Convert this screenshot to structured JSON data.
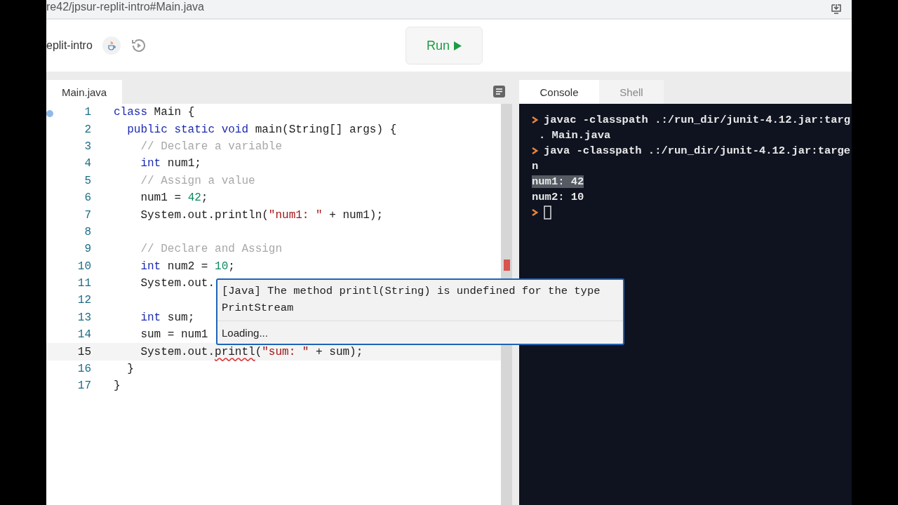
{
  "address_bar": {
    "url": "re42/jpsur-replit-intro#Main.java"
  },
  "header": {
    "project_name": "eplit-intro",
    "run_button": {
      "label": "Run"
    }
  },
  "editor": {
    "tabs": [
      {
        "label": "Main.java",
        "selected": true
      }
    ],
    "lines": [
      {
        "number": "1",
        "current": false,
        "marker": true,
        "tokens": [
          {
            "kind": "keyword",
            "text": "class"
          },
          {
            "kind": "plain",
            "text": " Main {"
          }
        ]
      },
      {
        "number": "2",
        "current": false,
        "marker": false,
        "tokens": [
          {
            "kind": "keyword",
            "text": "  public static void"
          },
          {
            "kind": "plain",
            "text": " main(String[] args) {"
          }
        ]
      },
      {
        "number": "3",
        "current": false,
        "marker": false,
        "tokens": [
          {
            "kind": "comment",
            "text": "    // Declare a variable"
          }
        ]
      },
      {
        "number": "4",
        "current": false,
        "marker": false,
        "tokens": [
          {
            "kind": "keyword",
            "text": "    int"
          },
          {
            "kind": "plain",
            "text": " num1;"
          }
        ]
      },
      {
        "number": "5",
        "current": false,
        "marker": false,
        "tokens": [
          {
            "kind": "comment",
            "text": "    // Assign a value"
          }
        ]
      },
      {
        "number": "6",
        "current": false,
        "marker": false,
        "tokens": [
          {
            "kind": "plain",
            "text": "    num1 = "
          },
          {
            "kind": "number",
            "text": "42"
          },
          {
            "kind": "plain",
            "text": ";"
          }
        ]
      },
      {
        "number": "7",
        "current": false,
        "marker": false,
        "tokens": [
          {
            "kind": "plain",
            "text": "    System.out.println("
          },
          {
            "kind": "string",
            "text": "\"num1: \""
          },
          {
            "kind": "plain",
            "text": " + num1);"
          }
        ]
      },
      {
        "number": "8",
        "current": false,
        "marker": false
      },
      {
        "number": "9",
        "current": false,
        "marker": false,
        "tokens": [
          {
            "kind": "comment",
            "text": "    // Declare and Assign"
          }
        ]
      },
      {
        "number": "10",
        "current": false,
        "marker": false,
        "tokens": [
          {
            "kind": "keyword",
            "text": "    int"
          },
          {
            "kind": "plain",
            "text": " num2 = "
          },
          {
            "kind": "number",
            "text": "10"
          },
          {
            "kind": "plain",
            "text": ";"
          }
        ]
      },
      {
        "number": "11",
        "current": false,
        "marker": false,
        "tokens": [
          {
            "kind": "plain",
            "text": "    System.out."
          }
        ]
      },
      {
        "number": "12",
        "current": false,
        "marker": false
      },
      {
        "number": "13",
        "current": false,
        "marker": false,
        "tokens": [
          {
            "kind": "keyword",
            "text": "    int"
          },
          {
            "kind": "plain",
            "text": " sum;"
          }
        ]
      },
      {
        "number": "14",
        "current": false,
        "marker": false,
        "tokens": [
          {
            "kind": "plain",
            "text": "    sum = num1"
          }
        ]
      },
      {
        "number": "15",
        "current": true,
        "marker": false,
        "tokens": [
          {
            "kind": "plain",
            "text": "    System.out."
          },
          {
            "kind": "error",
            "text": "printl"
          },
          {
            "kind": "plain",
            "text": "("
          },
          {
            "kind": "string",
            "text": "\"sum: \""
          },
          {
            "kind": "plain",
            "text": " + sum);"
          }
        ]
      },
      {
        "number": "16",
        "current": false,
        "marker": false,
        "tokens": [
          {
            "kind": "plain",
            "text": "  }"
          }
        ]
      },
      {
        "number": "17",
        "current": false,
        "marker": false,
        "tokens": [
          {
            "kind": "plain",
            "text": "}"
          }
        ]
      }
    ],
    "hover_popup": {
      "message": "[Java] The method printl(String) is undefined for the type PrintStream",
      "status": "Loading..."
    }
  },
  "console": {
    "tabs": [
      {
        "label": "Console",
        "selected": true
      },
      {
        "label": "Shell",
        "selected": false
      }
    ],
    "lines": [
      {
        "kind": "command",
        "text": "javac -classpath .:/run_dir/junit-4.12.jar:targ"
      },
      {
        "kind": "wrap",
        "text": ". Main.java"
      },
      {
        "kind": "command",
        "text": "java -classpath .:/run_dir/junit-4.12.jar:targe"
      },
      {
        "kind": "output",
        "text": "n",
        "highlighted": false
      },
      {
        "kind": "output",
        "text": "num1: 42",
        "highlighted": true
      },
      {
        "kind": "output",
        "text": "num2: 10",
        "highlighted": false
      },
      {
        "kind": "prompt"
      }
    ]
  }
}
